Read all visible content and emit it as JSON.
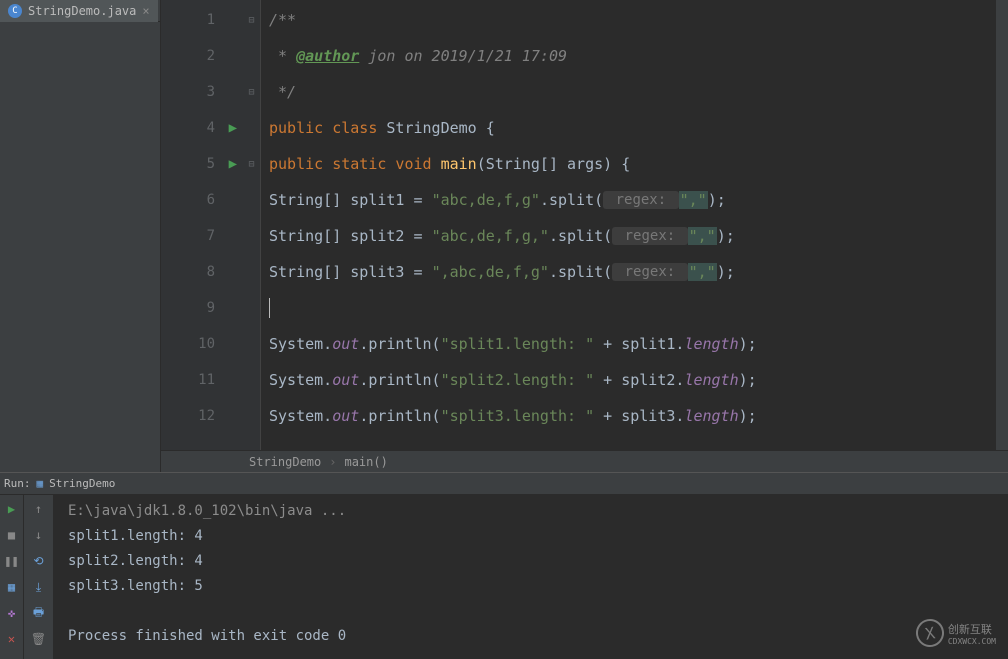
{
  "tab": {
    "filename": "StringDemo.java",
    "icon_letter": "C"
  },
  "gutter": {
    "lines": [
      "1",
      "2",
      "3",
      "4",
      "5",
      "6",
      "7",
      "8",
      "9",
      "10",
      "11",
      "12"
    ],
    "run_markers": [
      4,
      5
    ]
  },
  "code": {
    "l1_comment": "/**",
    "l2_pre": " * ",
    "l2_tag": "@author",
    "l2_rest": " jon on 2019/1/21 17:09",
    "l3_comment": " */",
    "l4_kw1": "public ",
    "l4_kw2": "class ",
    "l4_name": "StringDemo ",
    "l4_brace": "{",
    "l5_kw": "public static void ",
    "l5_method": "main",
    "l5_sig1": "(String[] args) ",
    "l5_brace": "{",
    "l6_decl": "String[] split1 = ",
    "l6_str": "\"abc,de,f,g\"",
    "l6_call": ".split(",
    "l6_hint": " regex: ",
    "l6_arg": "\",\"",
    "l6_end": ");",
    "l7_decl": "String[] split2 = ",
    "l7_str": "\"abc,de,f,g,\"",
    "l7_call": ".split(",
    "l7_hint": " regex: ",
    "l7_arg": "\",\"",
    "l7_end": ");",
    "l8_decl": "String[] split3 = ",
    "l8_str": "\",abc,de,f,g\"",
    "l8_call": ".split(",
    "l8_hint": " regex: ",
    "l8_arg": "\",\"",
    "l8_end": ");",
    "l10_sys": "System.",
    "l10_out": "out",
    "l10_call": ".println(",
    "l10_str": "\"split1.length: \"",
    "l10_plus": " + split1.",
    "l10_len": "length",
    "l10_end": ");",
    "l11_sys": "System.",
    "l11_out": "out",
    "l11_call": ".println(",
    "l11_str": "\"split2.length: \"",
    "l11_plus": " + split2.",
    "l11_len": "length",
    "l11_end": ");",
    "l12_sys": "System.",
    "l12_out": "out",
    "l12_call": ".println(",
    "l12_str": "\"split3.length: \"",
    "l12_plus": " + split3.",
    "l12_len": "length",
    "l12_end": ");"
  },
  "breadcrumb": {
    "part1": "StringDemo",
    "part2": "main()"
  },
  "run": {
    "title_prefix": "Run:",
    "config_name": "StringDemo",
    "cmd": "E:\\java\\jdk1.8.0_102\\bin\\java ...",
    "out1": "split1.length: 4",
    "out2": "split2.length: 4",
    "out3": "split3.length: 5",
    "exit": "Process finished with exit code 0"
  },
  "watermark": {
    "logo": "X",
    "text": "创新互联",
    "sub": "CDXWCX.COM"
  }
}
